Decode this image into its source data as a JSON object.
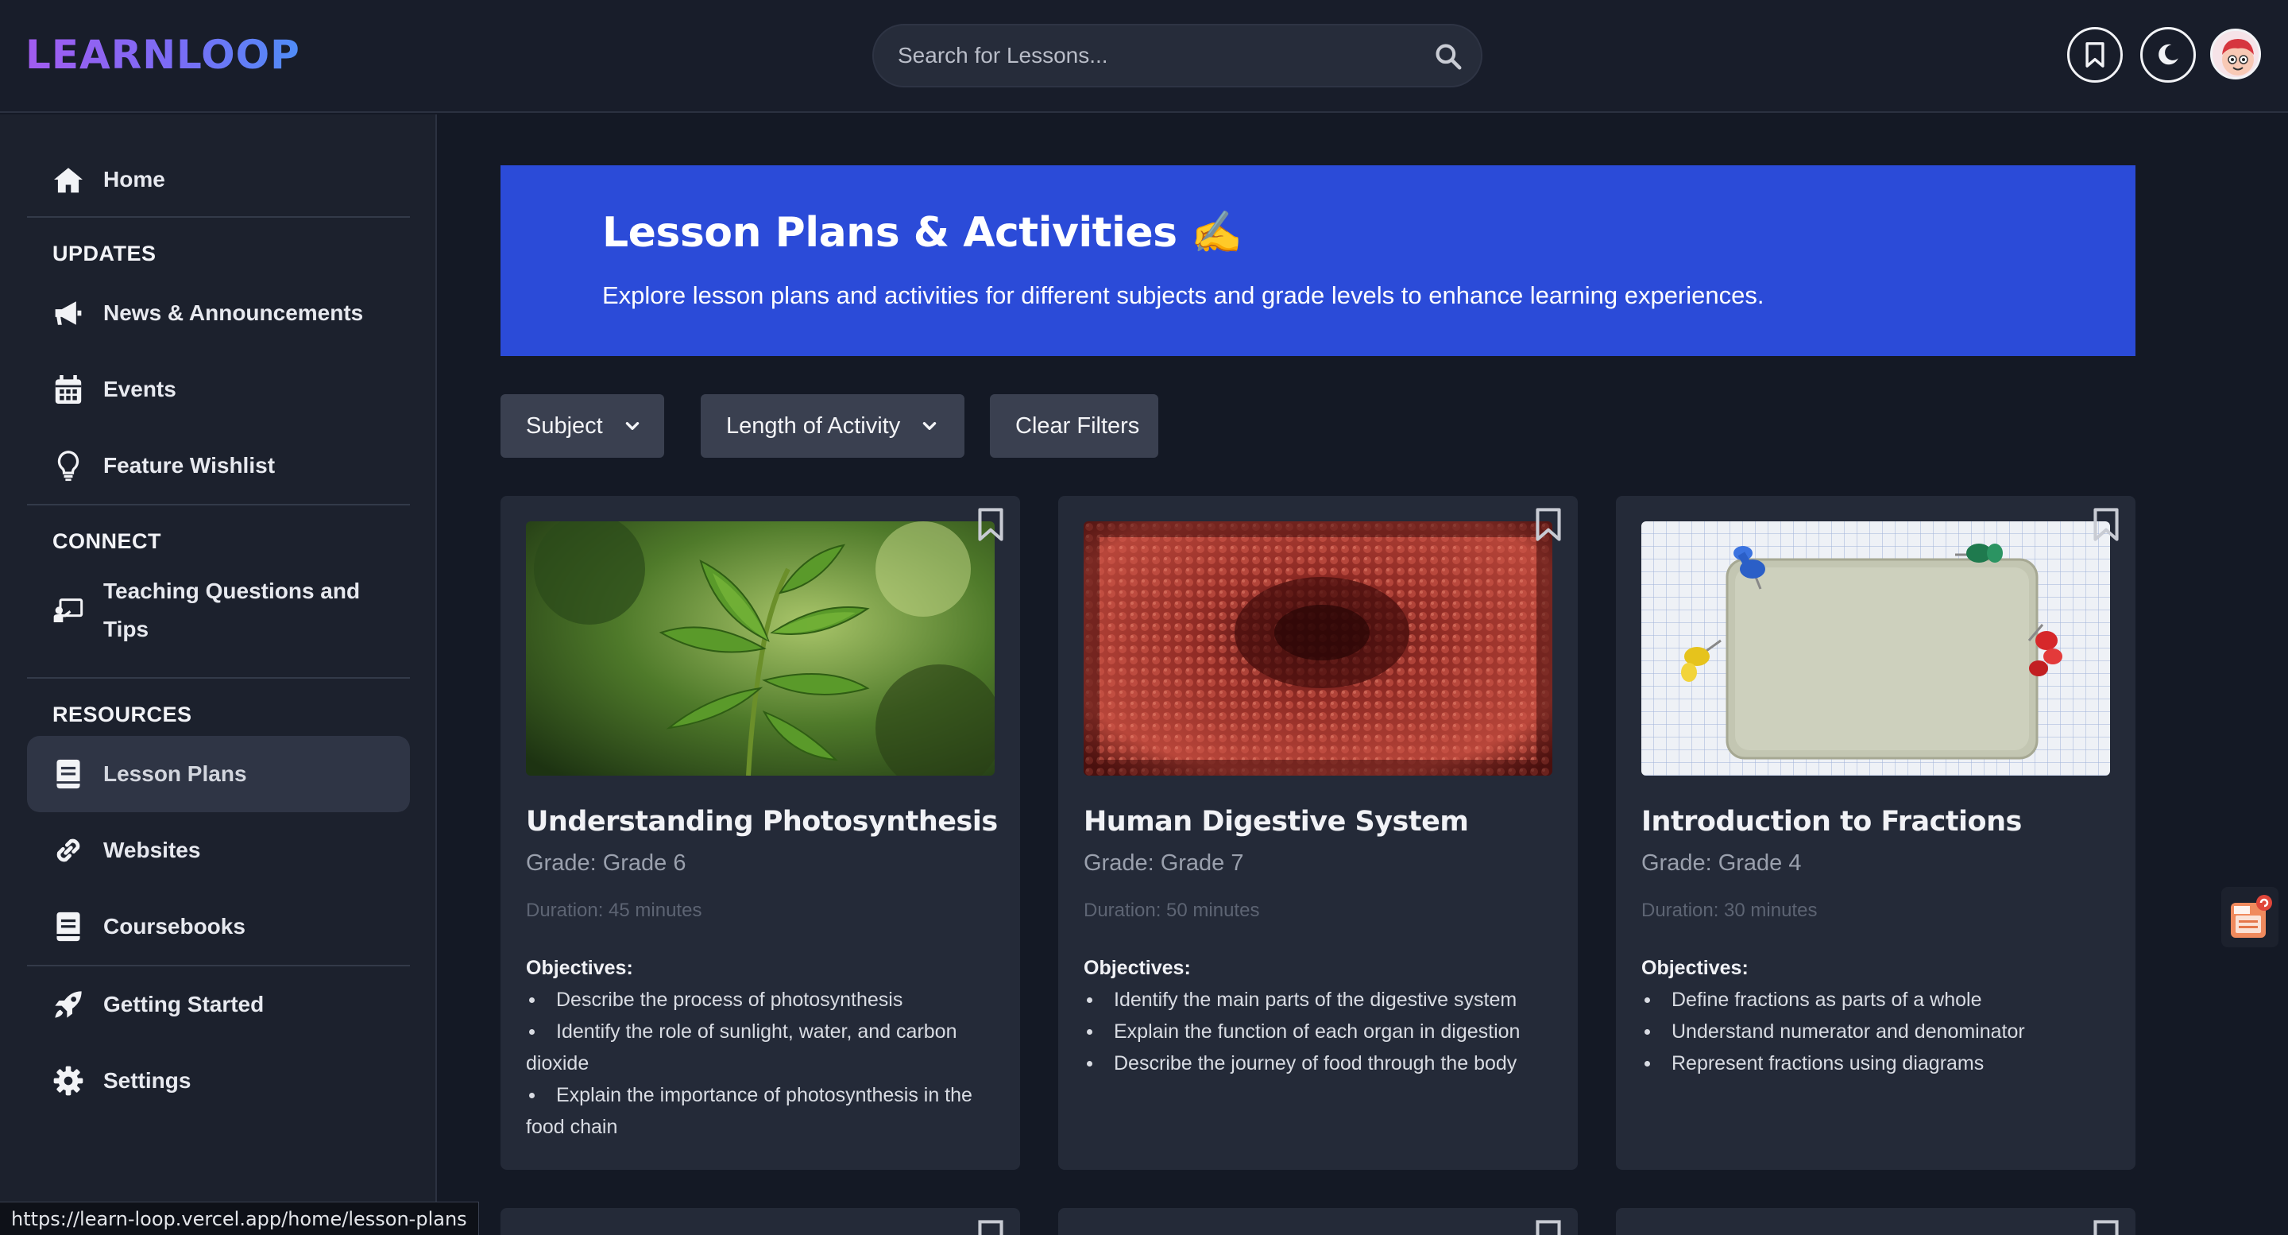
{
  "header": {
    "logo_text": "LEARNLOOP",
    "search_placeholder": "Search for Lessons...",
    "icons": [
      "bookmark-icon",
      "moon-icon",
      "avatar"
    ]
  },
  "sidebar": {
    "home": "Home",
    "sections": [
      {
        "label": "UPDATES",
        "items": [
          "News & Announcements",
          "Events",
          "Feature Wishlist"
        ]
      },
      {
        "label": "CONNECT",
        "items": [
          "Teaching Questions and Tips"
        ]
      },
      {
        "label": "RESOURCES",
        "items": [
          "Lesson Plans",
          "Websites",
          "Coursebooks"
        ]
      }
    ],
    "footer_items": [
      "Getting Started",
      "Settings"
    ],
    "active_item": "Lesson Plans"
  },
  "hero": {
    "title": "Lesson Plans & Activities ✍️",
    "subtitle": "Explore lesson plans and activities for different subjects and grade levels to enhance learning experiences.",
    "background": "#2b4bd8"
  },
  "filters": {
    "subject": "Subject",
    "length": "Length of Activity",
    "clear": "Clear Filters"
  },
  "lessons": [
    {
      "title": "Understanding Photosynthesis",
      "grade": "Grade: Grade 6",
      "duration": "Duration: 45 minutes",
      "objectives_label": "Objectives:",
      "objectives": [
        "Describe the process of photosynthesis",
        "Identify the role of sunlight, water, and carbon dioxide",
        "Explain the importance of photosynthesis in the food chain"
      ]
    },
    {
      "title": "Human Digestive System",
      "grade": "Grade: Grade 7",
      "duration": "Duration: 50 minutes",
      "objectives_label": "Objectives:",
      "objectives": [
        "Identify the main parts of the digestive system",
        "Explain the function of each organ in digestion",
        "Describe the journey of food through the body"
      ]
    },
    {
      "title": "Introduction to Fractions",
      "grade": "Grade: Grade 4",
      "duration": "Duration: 30 minutes",
      "objectives_label": "Objectives:",
      "objectives": [
        "Define fractions as parts of a whole",
        "Understand numerator and denominator",
        "Represent fractions using diagrams"
      ]
    }
  ],
  "status_url": "https://learn-loop.vercel.app/home/lesson-plans"
}
